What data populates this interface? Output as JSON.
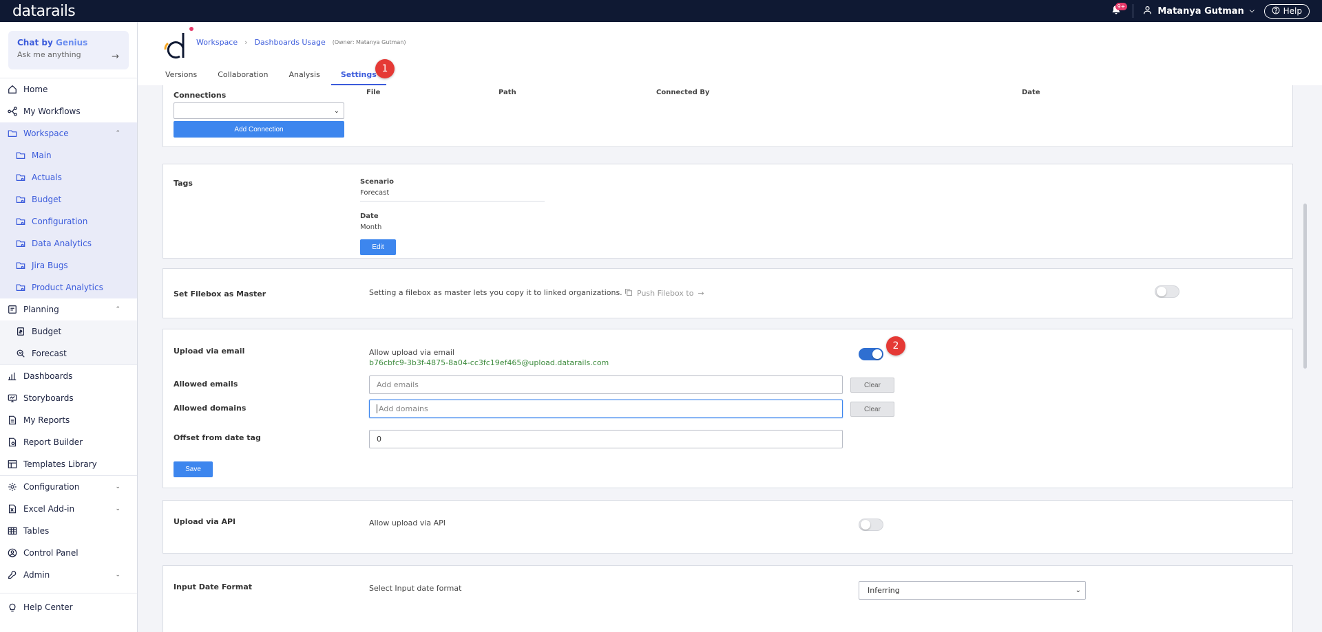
{
  "topbar": {
    "logo": "datarails",
    "notification_count": "9+",
    "user_name": "Matanya Gutman",
    "help_label": "Help"
  },
  "sidebar": {
    "genius_title": "Chat by",
    "genius_title_accent": "Genius",
    "genius_subtitle": "Ask me anything",
    "items": [
      {
        "label": "Home",
        "icon": "home-icon"
      },
      {
        "label": "My Workflows",
        "icon": "workflow-icon"
      },
      {
        "label": "Workspace",
        "icon": "folder-icon"
      },
      {
        "label": "Main",
        "icon": "folder-icon"
      },
      {
        "label": "Actuals",
        "icon": "folder-link-icon"
      },
      {
        "label": "Budget",
        "icon": "folder-link-icon"
      },
      {
        "label": "Configuration",
        "icon": "folder-link-icon"
      },
      {
        "label": "Data Analytics",
        "icon": "folder-link-icon"
      },
      {
        "label": "Jira Bugs",
        "icon": "folder-link-icon"
      },
      {
        "label": "Product Analytics",
        "icon": "folder-link-icon"
      },
      {
        "label": "Planning",
        "icon": "planning-icon"
      },
      {
        "label": "Budget",
        "icon": "budget-icon"
      },
      {
        "label": "Forecast",
        "icon": "forecast-icon"
      },
      {
        "label": "Dashboards",
        "icon": "dashboard-icon"
      },
      {
        "label": "Storyboards",
        "icon": "storyboard-icon"
      },
      {
        "label": "My Reports",
        "icon": "report-icon"
      },
      {
        "label": "Report Builder",
        "icon": "report-builder-icon"
      },
      {
        "label": "Templates Library",
        "icon": "templates-icon"
      },
      {
        "label": "Configuration",
        "icon": "gear-icon"
      },
      {
        "label": "Excel Add-in",
        "icon": "excel-icon"
      },
      {
        "label": "Tables",
        "icon": "table-icon"
      },
      {
        "label": "Control Panel",
        "icon": "control-panel-icon"
      },
      {
        "label": "Admin",
        "icon": "admin-icon"
      },
      {
        "label": "Help Center",
        "icon": "lightbulb-icon"
      }
    ]
  },
  "header": {
    "breadcrumb_workspace": "Workspace",
    "breadcrumb_file": "Dashboards Usage",
    "owner": "(Owner: Matanya Gutman)",
    "tabs": [
      "Versions",
      "Collaboration",
      "Analysis",
      "Settings"
    ],
    "marker_1": "1",
    "marker_2": "2"
  },
  "connections": {
    "label": "Connections",
    "col_file": "File",
    "col_path": "Path",
    "col_connected_by": "Connected By",
    "col_date": "Date",
    "add_button": "Add Connection"
  },
  "tags": {
    "label": "Tags",
    "scenario_label": "Scenario",
    "scenario_value": "Forecast",
    "date_label": "Date",
    "date_value": "Month",
    "edit_button": "Edit"
  },
  "master": {
    "label": "Set Filebox as Master",
    "description": "Setting a filebox as master lets you copy it to linked organizations.",
    "push_label": "Push Filebox to",
    "enabled": false
  },
  "email_upload": {
    "label": "Upload via email",
    "allow_label": "Allow upload via email",
    "address": "b76cbfc9-3b3f-4875-8a04-cc3fc19ef465@upload.datarails.com",
    "enabled": true,
    "allowed_emails_label": "Allowed emails",
    "allowed_emails_placeholder": "Add emails",
    "allowed_domains_label": "Allowed domains",
    "allowed_domains_placeholder": "Add domains",
    "clear_label": "Clear",
    "offset_label": "Offset from date tag",
    "offset_value": "0",
    "save_button": "Save"
  },
  "api_upload": {
    "label": "Upload via API",
    "allow_label": "Allow upload via API",
    "enabled": false
  },
  "date_format": {
    "label": "Input Date Format",
    "select_label": "Select Input date format",
    "selected": "Inferring"
  },
  "colors": {
    "topbar": "#0f1933",
    "accent": "#3b5bdb",
    "button": "#3d86ee",
    "marker": "#e53935"
  }
}
